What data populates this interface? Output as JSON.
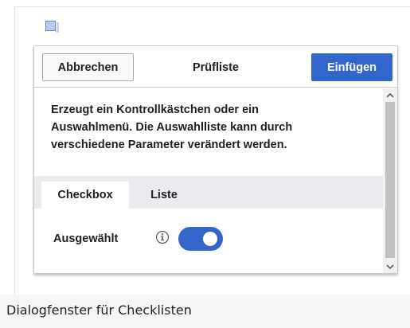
{
  "dialog": {
    "cancel_label": "Abbrechen",
    "title": "Prüfliste",
    "insert_label": "Einfügen",
    "description_lines": [
      "Erzeugt ein Kontrollkästchen oder ein",
      "Auswahlmenü. Die Auswahlliste kann durch",
      "verschiedene Parameter verändert werden."
    ],
    "tabs": [
      {
        "label": "Checkbox",
        "selected": true
      },
      {
        "label": "Liste",
        "selected": false
      }
    ],
    "field": {
      "label": "Ausgewählt",
      "info_icon": "info-icon",
      "toggle_on": true
    }
  },
  "caption": "Dialogfenster für Checklisten",
  "colors": {
    "primary": "#3366cc",
    "tab_bar": "#eaecf0",
    "border": "#c8ccd1",
    "caption_bg": "#f6f6f6"
  }
}
